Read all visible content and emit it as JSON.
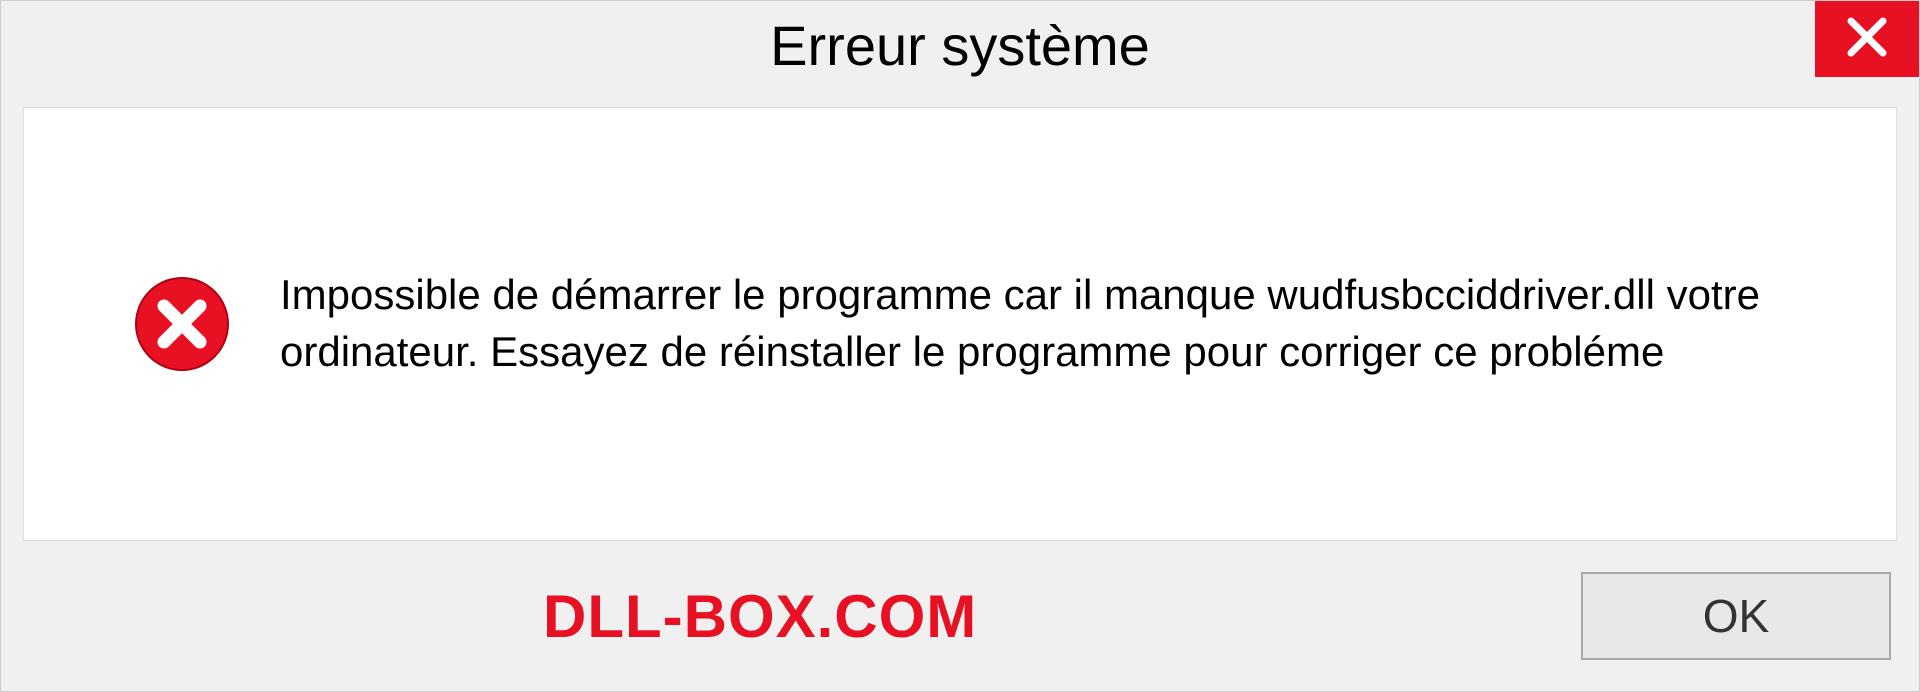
{
  "dialog": {
    "title": "Erreur système",
    "message": "Impossible de démarrer le programme car il manque wudfusbcciddriver.dll votre ordinateur. Essayez de réinstaller le programme pour corriger ce probléme",
    "watermark": "DLL-BOX.COM",
    "ok_label": "OK"
  }
}
